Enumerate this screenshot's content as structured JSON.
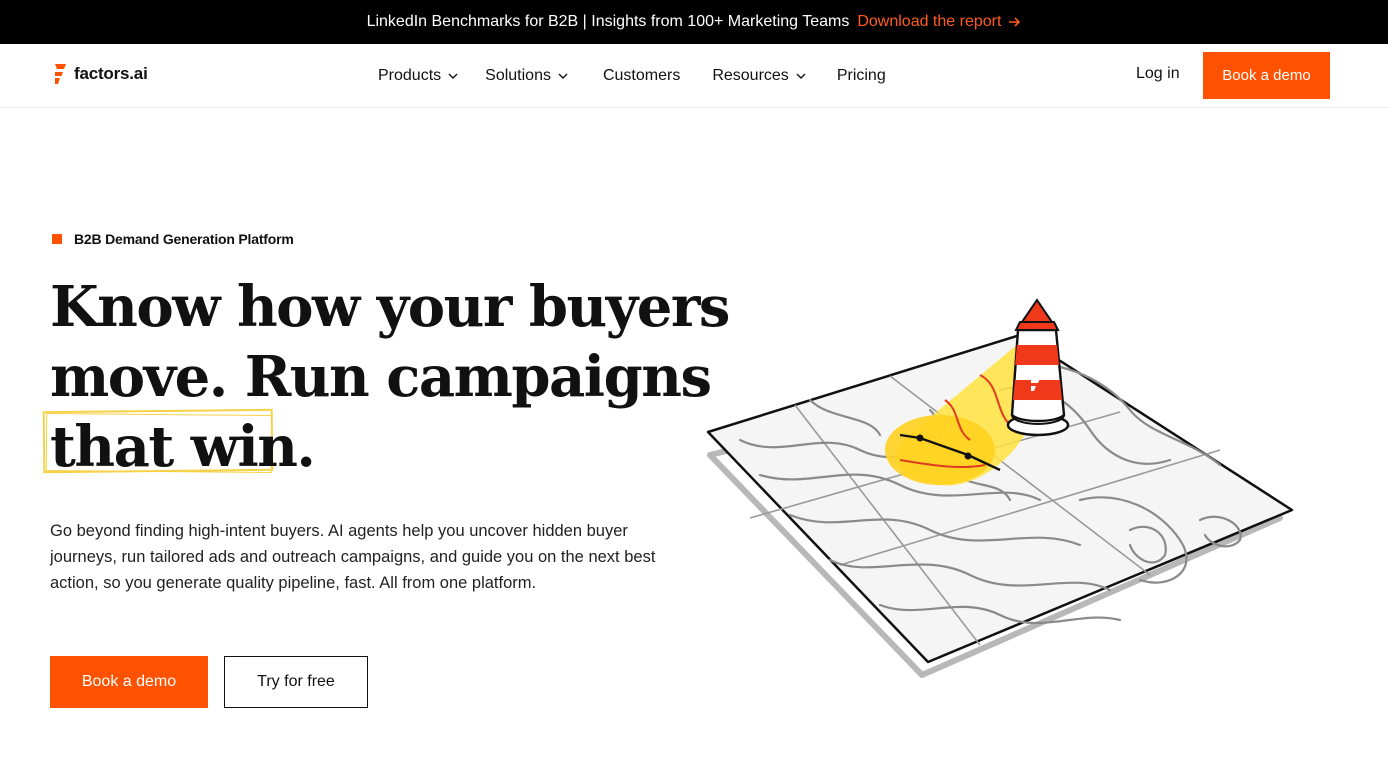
{
  "announcement": {
    "text": "LinkedIn Benchmarks for B2B | Insights from 100+ Marketing Teams",
    "cta": "Download the report",
    "cta_icon": "arrow-right-icon"
  },
  "nav": {
    "logo_text": "factors.ai",
    "logo_icon": "factors-logo-icon",
    "items": [
      {
        "label": "Products",
        "has_dropdown": true
      },
      {
        "label": "Solutions",
        "has_dropdown": true
      },
      {
        "label": "Customers",
        "has_dropdown": false
      },
      {
        "label": "Resources",
        "has_dropdown": true
      },
      {
        "label": "Pricing",
        "has_dropdown": false
      }
    ],
    "login": "Log in",
    "book_demo": "Book a demo"
  },
  "hero": {
    "eyebrow": "B2B Demand Generation Platform",
    "headline_line1": "Know how your buyers",
    "headline_line2": "move. Run campaigns",
    "headline_highlight": "that win.",
    "description": "Go beyond finding high-intent buyers. AI agents help you uncover hidden buyer journeys, run tailored ads and outreach campaigns, and guide you on the next best action, so you generate quality pipeline, fast. All from one platform.",
    "primary_cta": "Book a demo",
    "secondary_cta": "Try for free",
    "illustration": "lighthouse-on-topographic-map"
  },
  "colors": {
    "brand": "#ff5200",
    "highlight": "#f6d24a",
    "announcement_bg": "#000000"
  }
}
